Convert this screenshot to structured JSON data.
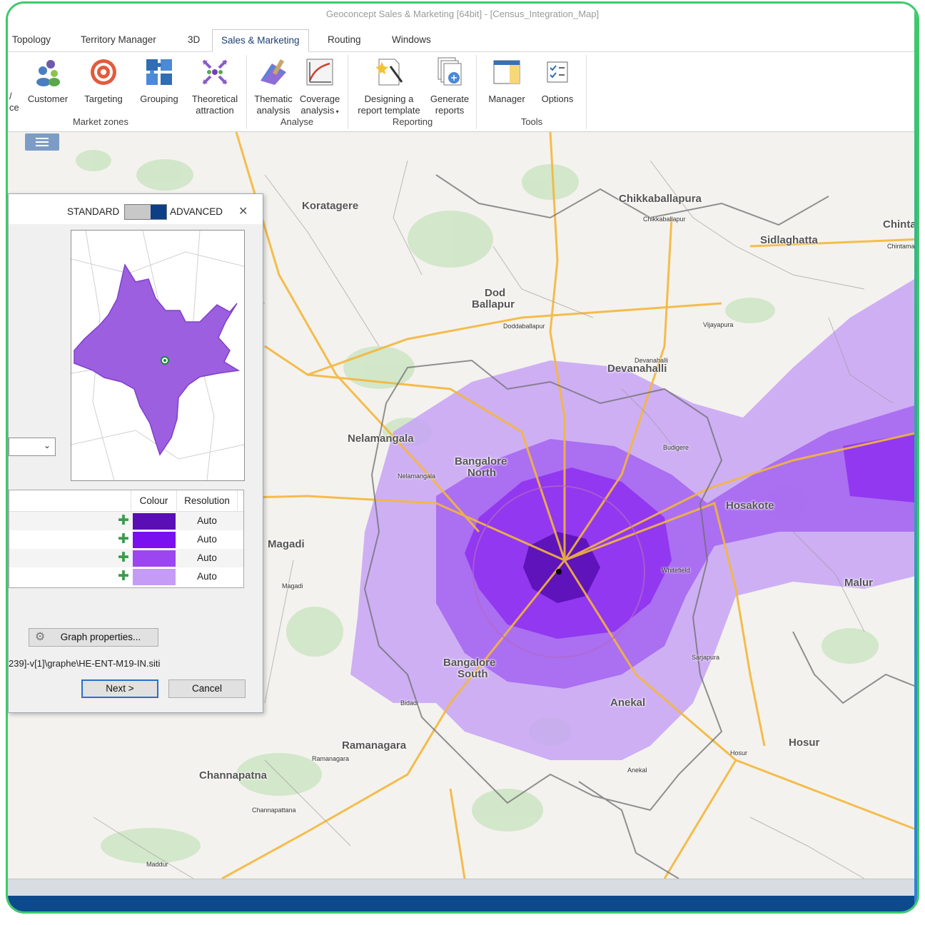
{
  "window": {
    "title": "Geoconcept Sales & Marketing [64bit] - [Census_Integration_Map]"
  },
  "tabs": [
    "Topology",
    "Territory Manager",
    "3D",
    "Sales & Marketing",
    "Routing",
    "Windows"
  ],
  "active_tab": "Sales & Marketing",
  "ribbon": {
    "partial_left": [
      "/",
      "ce"
    ],
    "groups": [
      {
        "label": "Market zones",
        "buttons": [
          "Customer",
          "Targeting",
          "Grouping",
          "Theoretical",
          "attraction"
        ]
      },
      {
        "label": "Analyse",
        "buttons": [
          "Thematic",
          "analysis",
          "Coverage",
          "analysis"
        ]
      },
      {
        "label": "Reporting",
        "buttons": [
          "Designing a",
          "report template",
          "Generate",
          "reports"
        ]
      },
      {
        "label": "Tools",
        "buttons": [
          "Manager",
          "Options"
        ]
      }
    ]
  },
  "map": {
    "places": [
      "Koratagere",
      "Chikkaballapura",
      "Chikkaballapur",
      "Chinta",
      "Chintaman",
      "Sidlaghatta",
      "Dod",
      "Ballapur",
      "Doddaballapur",
      "Vijayapura",
      "Devanahalli",
      "Devanahalli",
      "Nelamangala",
      "Nelamangala",
      "Bangalore",
      "North",
      "Budigere",
      "Hosakote",
      "Magadi",
      "Magadi",
      "Whitefield",
      "Malur",
      "Bangalore",
      "South",
      "Sarjapura",
      "Bidadi",
      "Anekal",
      "Anekal",
      "Ramanagara",
      "Ramanagara",
      "Hosur",
      "Hosur",
      "Channapatna",
      "Channapattana",
      "Maddur"
    ],
    "overlay_colors": [
      "#5a0fb4",
      "#7a1fe6",
      "#9a4cf0",
      "#c29af4"
    ],
    "center_marker": "black-dot"
  },
  "dialog": {
    "mode_standard": "STANDARD",
    "mode_advanced": "ADVANCED",
    "close_icon": "close-icon",
    "table": {
      "headers": {
        "colour": "Colour",
        "resolution": "Resolution"
      },
      "rows": [
        {
          "color": "#5a0fb4",
          "resolution": "Auto"
        },
        {
          "color": "#7a0ff0",
          "resolution": "Auto"
        },
        {
          "color": "#9d45f0",
          "resolution": "Auto"
        },
        {
          "color": "#c49cf5",
          "resolution": "Auto"
        }
      ]
    },
    "graph_button": "Graph properties...",
    "path": "239]-v[1]\\graphe\\HE-ENT-M19-IN.siti",
    "next_button": "Next >",
    "cancel_button": "Cancel"
  }
}
